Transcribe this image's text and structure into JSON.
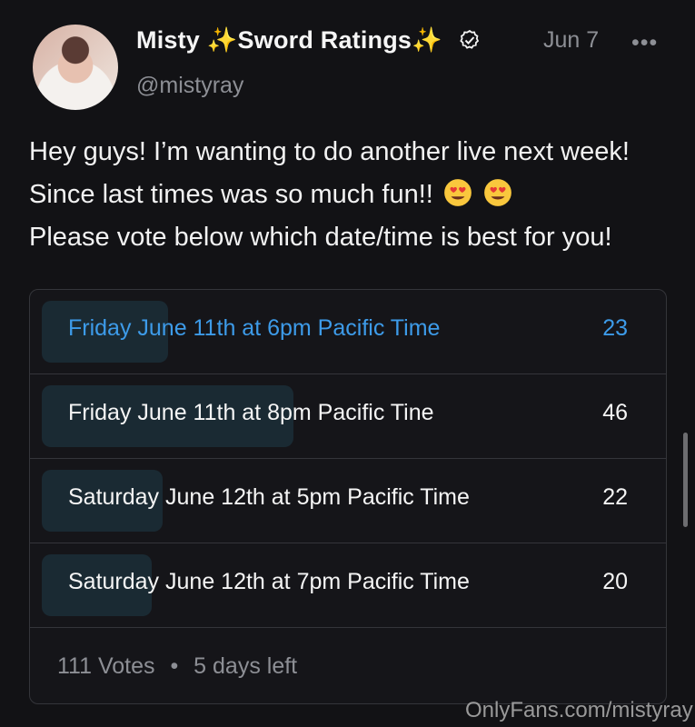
{
  "post": {
    "author": {
      "name": "Misty ✨Sword Ratings✨",
      "handle": "@mistyray",
      "verified": true
    },
    "date": "Jun 7",
    "more_menu": "•••",
    "text_before_emoji": "Hey guys! I’m wanting to do another live next week! Since last times was so much fun!!",
    "text_after_emoji": "Please vote below which date/time is best for you!",
    "emojis": [
      "heart-eyes-emoji",
      "heart-eyes-emoji"
    ]
  },
  "poll": {
    "options": [
      {
        "label": "Friday June 11th at 6pm Pacific Time",
        "count": "23",
        "share": 0.207,
        "selected": true
      },
      {
        "label": "Friday June 11th at 8pm Pacific Tine",
        "count": "46",
        "share": 0.414,
        "selected": false
      },
      {
        "label": "Saturday June 12th at 5pm Pacific Time",
        "count": "22",
        "share": 0.198,
        "selected": false
      },
      {
        "label": "Saturday June 12th at 7pm Pacific Time",
        "count": "20",
        "share": 0.18,
        "selected": false
      }
    ],
    "votes": "111 Votes",
    "separator": "•",
    "time_left": "5 days left"
  },
  "watermark": "OnlyFans.com/mistyray",
  "colors": {
    "background": "#121215",
    "accent": "#3d9be9",
    "muted": "#8d8f95",
    "fill": "#1a2a33"
  }
}
